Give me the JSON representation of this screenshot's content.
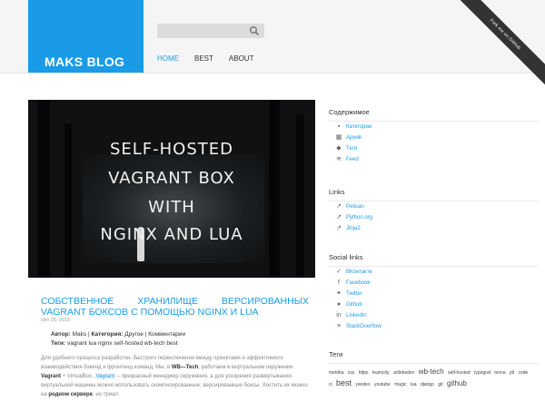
{
  "header": {
    "logo": "MAKS BLOG",
    "ribbon": "Fork me on GitHub",
    "nav": [
      "HOME",
      "BEST",
      "ABOUT"
    ]
  },
  "hero": {
    "lines": [
      "SELF-HOSTED",
      "VAGRANT BOX",
      "WITH",
      "NGINX AND LUA"
    ]
  },
  "post": {
    "title": "Собственное хранилище версированных Vagrant боксов с помощью Nginx и Lua",
    "date": "Окт 25, 2016",
    "author_label": "Автор:",
    "author": "Maks",
    "category_label": "Категория:",
    "category": "Другое",
    "comments": "Комментарии",
    "tags_label": "Теги:",
    "tags": "vagrant lua nginx self-hosted wb-tech best",
    "excerpt_1": "Для удобного процесса разработки, быстрого переключения между проектами и эффективного взаимодействия бэкенд и фронтенд команд, Мы, в ",
    "excerpt_company": "WB—Tech",
    "excerpt_2": ", работаем в виртуальном окружении ",
    "excerpt_vagrant": "Vagrant",
    "excerpt_3": " + VirtualBox. ",
    "excerpt_code": "Vagrant",
    "excerpt_4": " – прекрасный менеджер окружения, а для ускорения развертывания виртуальной машины можно использовать скомпилированные, версированные боксы. Хостить их можно на ",
    "excerpt_server": "родном сервере",
    "excerpt_5": ", но триал"
  },
  "sidebar": {
    "contents_title": "Содержимое",
    "contents": [
      {
        "icon": "folder-icon",
        "label": "Категории"
      },
      {
        "icon": "calendar-icon",
        "label": "Архив"
      },
      {
        "icon": "tag-icon",
        "label": "Теги"
      },
      {
        "icon": "rss-icon",
        "label": "Feed"
      }
    ],
    "links_title": "Links",
    "links": [
      {
        "icon": "external-link-icon",
        "label": "Pelican"
      },
      {
        "icon": "external-link-icon",
        "label": "Python.org"
      },
      {
        "icon": "external-link-icon",
        "label": "Jinja2"
      }
    ],
    "social_title": "Social links",
    "social": [
      {
        "icon": "vk-icon",
        "label": "ВКонтакте"
      },
      {
        "icon": "facebook-icon",
        "label": "Facebook"
      },
      {
        "icon": "twitter-icon",
        "label": "Twitter"
      },
      {
        "icon": "github-icon",
        "label": "Github"
      },
      {
        "icon": "linkedin-icon",
        "label": "LinkedIn"
      },
      {
        "icon": "stackoverflow-icon",
        "label": "StackOverflow"
      }
    ],
    "tags_title": "Теги",
    "tags": [
      "metrika",
      "css",
      "https",
      "teamcity",
      "artlebedev",
      "wb-tech",
      "self-hosted",
      "typograf",
      "lenna",
      "pil",
      "code",
      "ci",
      "best",
      "yandex",
      "youtube",
      "magic",
      "lua",
      "django",
      "git",
      "github"
    ]
  },
  "colors": {
    "accent": "#1a9be8"
  }
}
